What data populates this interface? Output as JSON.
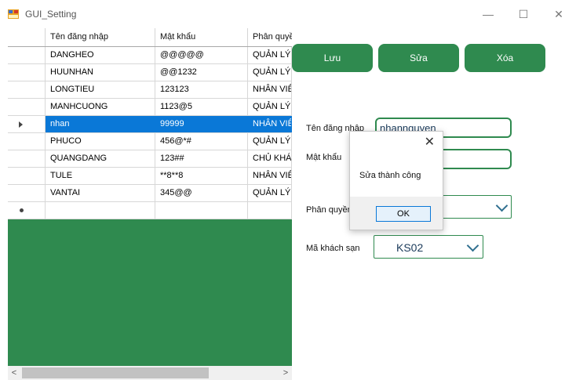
{
  "window": {
    "title": "GUI_Setting",
    "minimize": "—",
    "maximize": "☐",
    "close": "✕"
  },
  "grid": {
    "headers": [
      "Tên đăng nhập",
      "Mật khẩu",
      "Phân quyề"
    ],
    "rows": [
      [
        "DANGHEO",
        "@@@@@",
        "QUẢN LÝ"
      ],
      [
        "HUUNHAN",
        "@@1232",
        "QUẢN LÝ"
      ],
      [
        "LONGTIEU",
        "123123",
        "NHÂN VIÊ"
      ],
      [
        "MANHCUONG",
        "1123@5",
        "QUẢN LÝ"
      ],
      [
        "nhan",
        "99999",
        "NHÂN VIÊ"
      ],
      [
        "PHUCO",
        "456@*#",
        "QUẢN LÝ"
      ],
      [
        "QUANGDANG",
        "123##",
        "CHỦ KHÁC"
      ],
      [
        "TULE",
        "**8**8",
        "NHÂN VIÊ"
      ],
      [
        "VANTAI",
        "345@@",
        "QUẢN LÝ"
      ]
    ],
    "selected_row": 4,
    "scroll_left": "<",
    "scroll_right": ">"
  },
  "buttons": {
    "save": "Lưu",
    "edit": "Sửa",
    "delete": "Xóa"
  },
  "form": {
    "username_label": "Tên đăng nhập",
    "username_value": "nhannguyen",
    "password_label": "Mật khẩu",
    "password_value": "",
    "role_label": "Phân quyền",
    "hotel_label": "Mã khách sạn",
    "hotel_value": "KS02"
  },
  "dialog": {
    "message": "Sửa thành công",
    "ok": "OK",
    "close": "✕"
  }
}
